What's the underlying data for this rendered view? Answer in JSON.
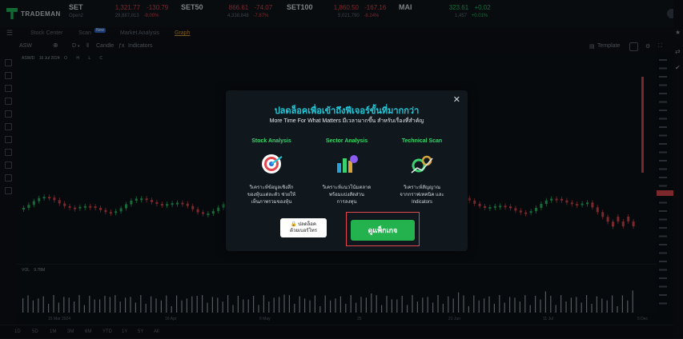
{
  "app": {
    "logo_text": "TRADEMAN"
  },
  "tickers": [
    {
      "name": "SET",
      "sub": "Open2",
      "value": "1,321.77",
      "change": "-130.79",
      "volume": "29,887,813",
      "pct": "-9.00%",
      "color": "red"
    },
    {
      "name": "SET50",
      "value": "866.61",
      "change": "-74.07",
      "volume": "4,338,848",
      "pct": "-7.87%",
      "color": "red"
    },
    {
      "name": "SET100",
      "value": "1,860.50",
      "change": "-167.16",
      "volume": "5,021,790",
      "pct": "-8.24%",
      "color": "red"
    },
    {
      "name": "MAI",
      "value": "323.61",
      "change": "+0.02",
      "volume": "1,457",
      "pct": "+0.01%",
      "color": "green"
    }
  ],
  "nav": {
    "items": [
      "Stock Center",
      "Scan",
      "Market Analysis",
      "Graph"
    ],
    "new_badge": "New"
  },
  "toolbar": {
    "symbol": "ASW",
    "interval": "D",
    "chart_type": "Candle",
    "indicators": "Indicators",
    "template": "Template"
  },
  "ohlc": {
    "symbol": "ASW/D",
    "date": "16 Jul 2024",
    "o": "O",
    "h": "H",
    "l": "L",
    "c": "C"
  },
  "volume_label": "VOL",
  "volume_value": "9.78M",
  "time_labels": [
    "15 Mar 2024",
    "16 Apr",
    "6 May",
    "25",
    "21 Jun",
    "11 Jul",
    "5 Dec"
  ],
  "bottom_ranges": [
    "1D",
    "5D",
    "1M",
    "3M",
    "6M",
    "YTD",
    "1Y",
    "5Y",
    "All"
  ],
  "modal": {
    "title": "ปลดล็อคเพื่อเข้าถึงฟีเจอร์ขั้นที่มากกว่า",
    "subtitle": "More Time For What Matters มีเวลามากขึ้น สำหรับเรื่องที่สำคัญ",
    "columns": [
      {
        "heading": "Stock Analysis",
        "desc": "วิเคราะห์ข้อมูลเชิงลึก\nของหุ้นแต่ละตัว ช่วยให้\nเห็นภาพรวมของหุ้น",
        "icon": "target-icon"
      },
      {
        "heading": "Sector Analysis",
        "desc": "วิเคราะห์แนวโน้มตลาด\nพร้อมแบ่งสัดส่วน\nการลงทุน",
        "icon": "sector-chart-icon"
      },
      {
        "heading": "Technical Scan",
        "desc": "วิเคราะห์สัญญาณ\nจากกราฟเทคนิค และ\nIndicators",
        "icon": "scan-gears-icon"
      }
    ],
    "unlock_button": "ปลดล็อค\nด้วยเบอร์โทร",
    "package_button": "ดูแพ็กเกจ"
  },
  "colors": {
    "up": "#27c46b",
    "down": "#e0474f",
    "accent": "#23c8d9"
  }
}
